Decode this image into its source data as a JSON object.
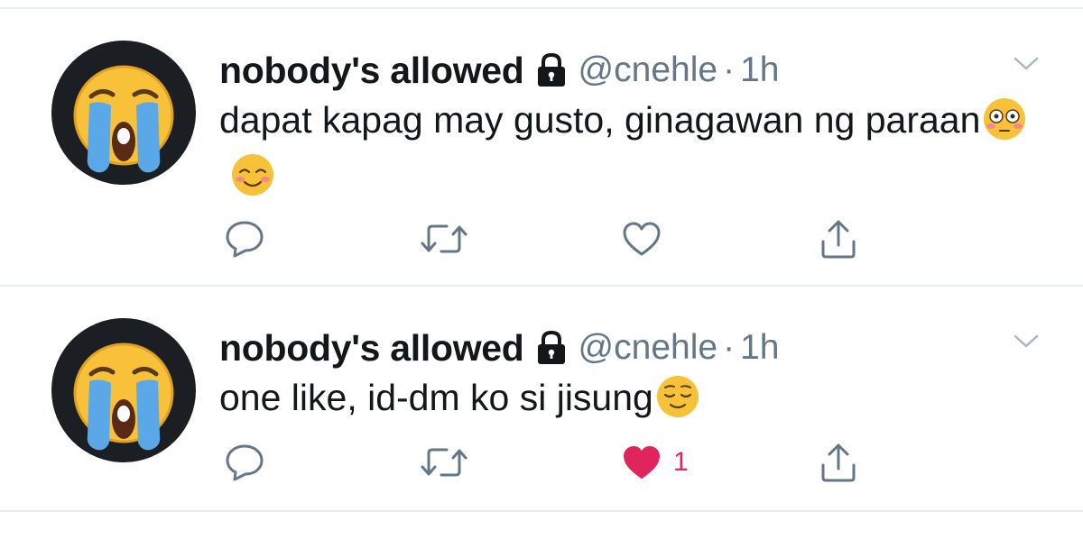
{
  "tweets": [
    {
      "display_name": "nobody's allowed",
      "handle": "@cnehle",
      "separator": "·",
      "time": "1h",
      "text": "dapat kapag may gusto, ginagawan ng paraan",
      "emojis": [
        "flushed-face",
        "smiling-face"
      ],
      "liked": false,
      "like_count": ""
    },
    {
      "display_name": "nobody's allowed",
      "handle": "@cnehle",
      "separator": "·",
      "time": "1h",
      "text": "one like, id-dm ko si jisung",
      "emojis": [
        "relieved-face"
      ],
      "liked": true,
      "like_count": "1"
    }
  ],
  "colors": {
    "secondary_text": "#657786",
    "like_active": "#e0245e",
    "divider": "#e6ecf0",
    "avatar_bg": "#1b1e22"
  },
  "icons": {
    "protected": "lock-icon",
    "menu": "chevron-down-icon",
    "reply": "reply-icon",
    "retweet": "retweet-icon",
    "like": "heart-icon",
    "share": "share-icon",
    "avatar": "loudly-crying-face-icon"
  }
}
